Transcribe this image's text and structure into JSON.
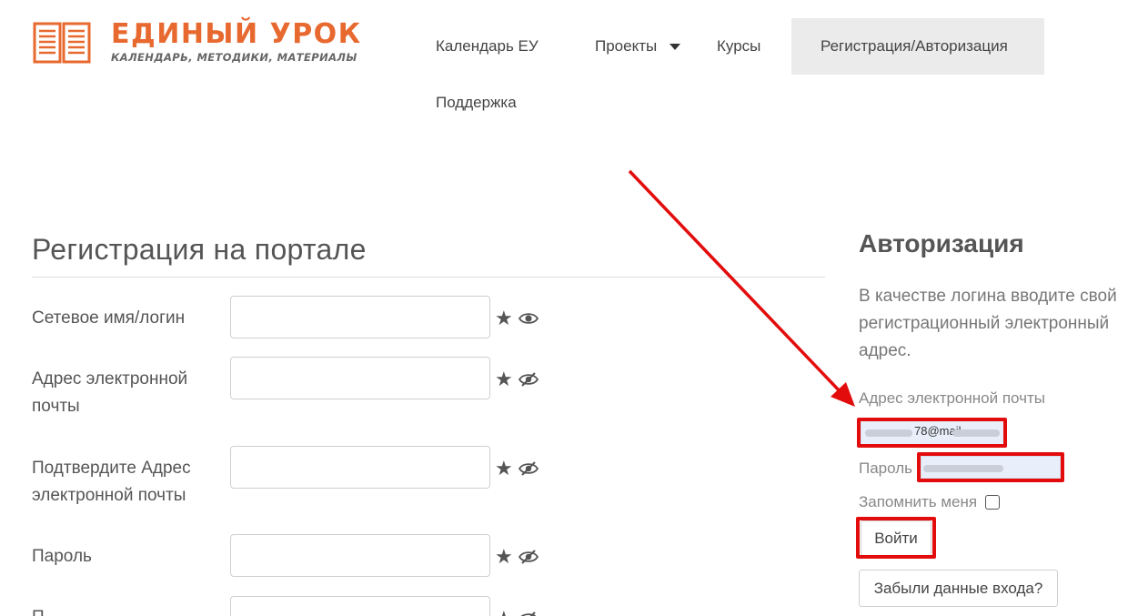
{
  "header": {
    "logo_title": "ЕДИНЫЙ УРОК",
    "logo_subtitle": "КАЛЕНДАРЬ, МЕТОДИКИ, МАТЕРИАЛЫ",
    "nav": {
      "calendar": "Календарь ЕУ",
      "projects": "Проекты",
      "courses": "Курсы",
      "register_login": "Регистрация/Авторизация",
      "support": "Поддержка"
    }
  },
  "registration": {
    "title": "Регистрация на портале",
    "fields": [
      {
        "label": "Сетевое имя/логин",
        "value": ""
      },
      {
        "label": "Адрес электронной почты",
        "value": ""
      },
      {
        "label": "Подтвердите Адрес электронной почты",
        "value": ""
      },
      {
        "label": "Пароль",
        "value": ""
      },
      {
        "label": "П",
        "value": ""
      }
    ]
  },
  "login": {
    "title": "Авторизация",
    "note": "В качестве логина вводите свой регистрационный электронный адрес.",
    "email_label": "Адрес электронной почты",
    "email_value": "78@mail",
    "password_label": "Пароль",
    "remember_label": "Запомнить меня",
    "remember_checked": false,
    "submit_label": "Войти",
    "forgot_label": "Забыли данные входа?"
  },
  "colors": {
    "brand": "#e8692f",
    "highlight": "#e30c0c",
    "autofill_bg": "#e8effa"
  },
  "icons": {
    "required": "star-icon",
    "show_password": "eye-icon",
    "hide_password": "eye-slash-icon",
    "dropdown": "caret-down-icon"
  }
}
